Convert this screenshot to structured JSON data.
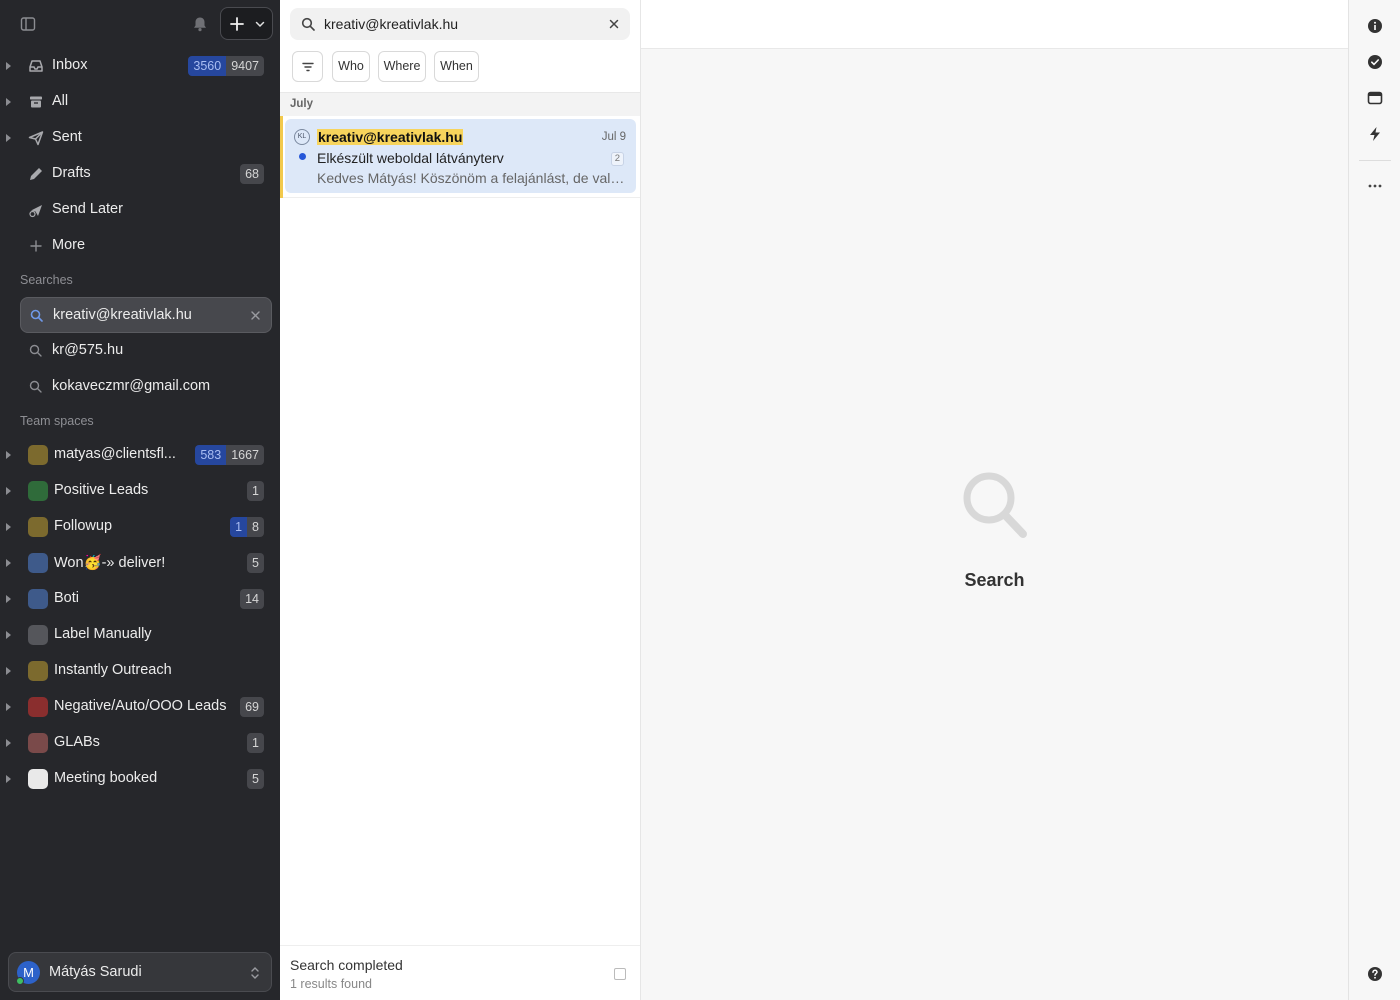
{
  "sidebar": {
    "nav": [
      {
        "label": "Inbox",
        "badge_unread": "3560",
        "badge_total": "9407",
        "icon": "inbox-icon"
      },
      {
        "label": "All",
        "icon": "archive-icon"
      },
      {
        "label": "Sent",
        "icon": "send-icon"
      },
      {
        "label": "Drafts",
        "badge_total": "68",
        "icon": "pencil-icon"
      },
      {
        "label": "Send Later",
        "icon": "send-later-icon"
      },
      {
        "label": "More",
        "icon": "plus-icon"
      }
    ],
    "searches_title": "Searches",
    "searches": [
      {
        "label": "kreativ@kreativlak.hu",
        "active": true
      },
      {
        "label": "kr@575.hu"
      },
      {
        "label": "kokaveczmr@gmail.com"
      }
    ],
    "team_title": "Team spaces",
    "teams": [
      {
        "label": "matyas@clientsfl...",
        "badge_unread": "583",
        "badge_total": "1667",
        "color": "#7c6a2e"
      },
      {
        "label": "Positive Leads",
        "badge_total": "1",
        "color": "#2f6b3a"
      },
      {
        "label": "Followup",
        "badge_unread": "1",
        "badge_total": "8",
        "color": "#7c6a2e"
      },
      {
        "label": "Won🥳-» deliver!",
        "badge_total": "5",
        "color": "#3e5a8a"
      },
      {
        "label": "Boti",
        "badge_total": "14",
        "color": "#3e5a8a"
      },
      {
        "label": "Label Manually",
        "badge_total": "",
        "color": "#55565b"
      },
      {
        "label": "Instantly Outreach",
        "badge_total": "",
        "color": "#7c6a2e"
      },
      {
        "label": "Negative/Auto/OOO Leads",
        "badge_total": "69",
        "color": "#8a2e2e"
      },
      {
        "label": "GLABs",
        "badge_total": "1",
        "color": "#7a4a4a"
      },
      {
        "label": "Meeting booked",
        "badge_total": "5",
        "color": "#e9e9e9"
      }
    ],
    "user": {
      "initial": "M",
      "name": "Mátyás Sarudi"
    }
  },
  "list": {
    "search_value": "kreativ@kreativlak.hu",
    "filters": [
      "Who",
      "Where",
      "When"
    ],
    "group": "July",
    "message": {
      "avatar": "KL",
      "from": "kreativ@kreativlak.hu",
      "date": "Jul 9",
      "subject": "Elkészült weboldal látványterv",
      "count": "2",
      "preview": "Kedves Mátyás! Köszönöm a felajánlást, de valószínűleg nem vagyunk célcsoport."
    },
    "status": "Search completed",
    "status_sub": "1 results found"
  },
  "reading": {
    "empty_label": "Search"
  }
}
